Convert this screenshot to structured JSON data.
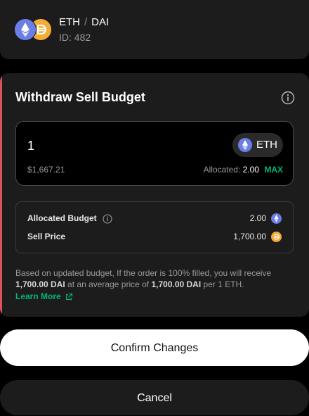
{
  "pair": {
    "base": "ETH",
    "separator": "/",
    "quote": "DAI",
    "id_text": "ID: 482"
  },
  "dialog": {
    "title": "Withdraw Sell Budget",
    "amount": {
      "value": "1",
      "token": "ETH",
      "usd_value": "$1,667.21",
      "allocated_label": "Allocated:",
      "allocated_value": "2.00",
      "max_label": "MAX"
    },
    "summary": {
      "allocated_budget_label": "Allocated Budget",
      "allocated_budget_value": "2.00",
      "sell_price_label": "Sell Price",
      "sell_price_value": "1,700.00"
    },
    "note": {
      "part1": "Based on updated budget, If the order is 100% filled, you will receive ",
      "amount": "1,700.00 DAI",
      "part2": " at an average price of ",
      "price": "1,700.00 DAI",
      "part3": " per 1 ETH."
    },
    "learn_more": "Learn More"
  },
  "buttons": {
    "confirm": "Confirm Changes",
    "cancel": "Cancel"
  },
  "colors": {
    "eth": "#6a7ee6",
    "dai": "#f5ac37",
    "accent_sell": "#d9525c",
    "green": "#00b578"
  },
  "icons": {
    "eth": "eth-icon",
    "dai": "dai-icon",
    "info": "info-icon",
    "external_link": "external-link-icon"
  }
}
